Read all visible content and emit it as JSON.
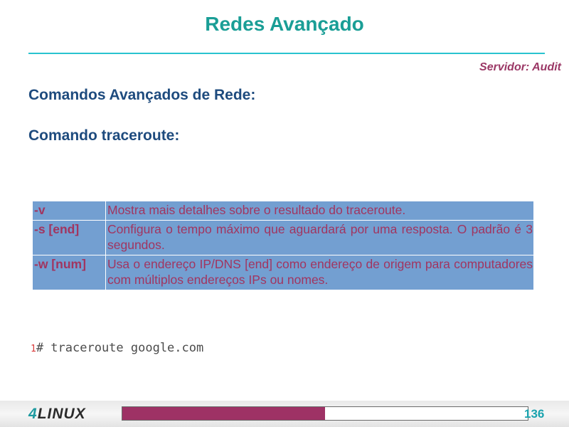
{
  "slide": {
    "title": "Redes Avançado",
    "server_label": "Servidor: Audit",
    "heading_1": "Comandos Avançados de Rede:",
    "heading_2": "Comando traceroute:"
  },
  "options_table": {
    "rows": [
      {
        "option": "-v",
        "description": "Mostra mais detalhes sobre o resultado do traceroute."
      },
      {
        "option": "-s [end]",
        "description": "Configura o tempo máximo que aguardará por uma resposta. O padrão é 3 segundos."
      },
      {
        "option": "-w [num]",
        "description": "Usa o endereço IP/DNS [end] como endereço de origem para computadores com múltiplos endereços IPs ou nomes."
      }
    ]
  },
  "command": {
    "line_number": "1",
    "text": "# traceroute google.com"
  },
  "footer": {
    "logo_digit": "4",
    "logo_text": "LINUX",
    "page_number": "136",
    "progress_fraction": 0.5
  },
  "colors": {
    "title": "#1a9e96",
    "rule": "#29c3cf",
    "server_label": "#9b3866",
    "heading": "#1e4b7e",
    "table_bg": "#739fd1",
    "table_text": "#a13560",
    "progress_fill": "#9e3265",
    "page_number": "#1aa3ae"
  }
}
